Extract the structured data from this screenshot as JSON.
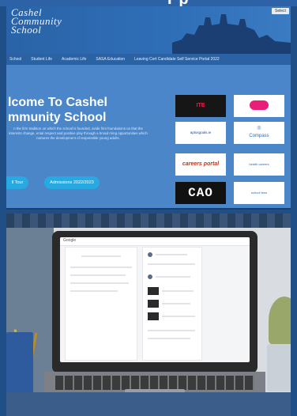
{
  "banner": {
    "title": "Pp"
  },
  "site": {
    "logo_lines": [
      "Cashel",
      "Community",
      "School"
    ],
    "language": "Select",
    "nav": [
      "School",
      "Student Life",
      "Academic Life",
      "SASA Education",
      "Leaving Cert Candidate Self Service Portal 2022"
    ],
    "hero_title": "lcome To Cashel mmunity School",
    "hero_text": "n the firm tradition on which the school is founded, ovide firm foundations on that the interests change, ental respect and positive play through a broad rning opportunities which nurtures the development of responsible young adults.",
    "buttons": [
      {
        "label": "ll Tour"
      },
      {
        "label": "Admissions 2022/2023"
      }
    ],
    "tiles": [
      {
        "label": "ITE"
      },
      {
        "label": ""
      },
      {
        "label": "aplusgoals.ie"
      },
      {
        "label": "Compass"
      },
      {
        "label": "careers portal"
      },
      {
        "label": "health careers"
      },
      {
        "label": "CAO"
      },
      {
        "label": "school fees"
      }
    ]
  },
  "app": {
    "name": "Google"
  }
}
